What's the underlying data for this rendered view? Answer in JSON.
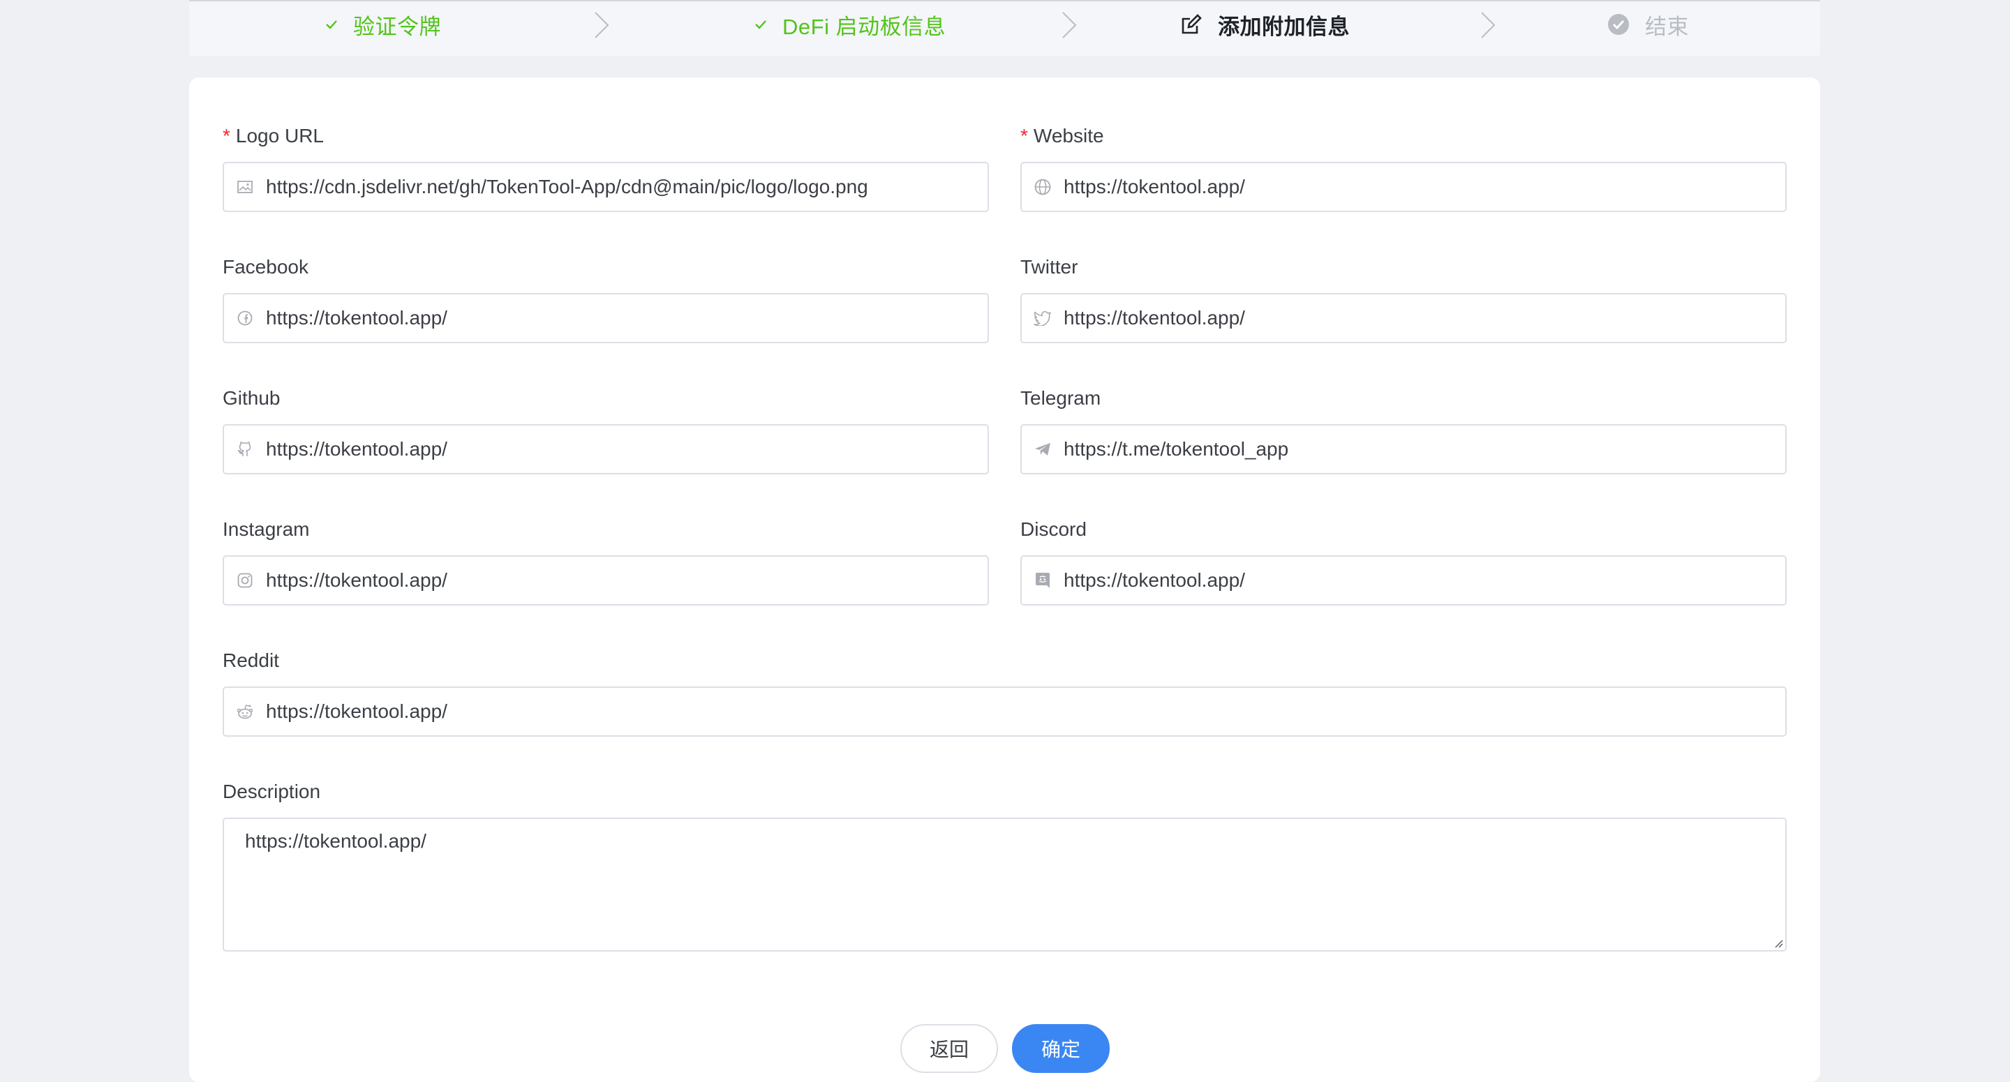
{
  "steps": [
    {
      "label": "验证令牌",
      "state": "done",
      "icon": "check-icon"
    },
    {
      "label": "DeFi 启动板信息",
      "state": "done",
      "icon": "check-icon"
    },
    {
      "label": "添加附加信息",
      "state": "active",
      "icon": "edit-icon"
    },
    {
      "label": "结束",
      "state": "wait",
      "icon": "check-circle-icon"
    }
  ],
  "form": {
    "logo_url": {
      "label": "Logo URL",
      "required": true,
      "icon": "image-icon",
      "value": "https://cdn.jsdelivr.net/gh/TokenTool-App/cdn@main/pic/logo/logo.png"
    },
    "website": {
      "label": "Website",
      "required": true,
      "icon": "globe-icon",
      "value": "https://tokentool.app/"
    },
    "facebook": {
      "label": "Facebook",
      "icon": "facebook-icon",
      "value": "https://tokentool.app/"
    },
    "twitter": {
      "label": "Twitter",
      "icon": "twitter-icon",
      "value": "https://tokentool.app/"
    },
    "github": {
      "label": "Github",
      "icon": "github-icon",
      "value": "https://tokentool.app/"
    },
    "telegram": {
      "label": "Telegram",
      "icon": "telegram-icon",
      "value": "https://t.me/tokentool_app"
    },
    "instagram": {
      "label": "Instagram",
      "icon": "instagram-icon",
      "value": "https://tokentool.app/"
    },
    "discord": {
      "label": "Discord",
      "icon": "discord-icon",
      "value": "https://tokentool.app/"
    },
    "reddit": {
      "label": "Reddit",
      "icon": "reddit-icon",
      "value": "https://tokentool.app/"
    },
    "description": {
      "label": "Description",
      "value": "https://tokentool.app/"
    }
  },
  "buttons": {
    "back": "返回",
    "confirm": "确定"
  },
  "colors": {
    "done": "#52c41a",
    "primary": "#3a87f3",
    "required": "#f5222d",
    "wait": "#b9bdc3"
  }
}
